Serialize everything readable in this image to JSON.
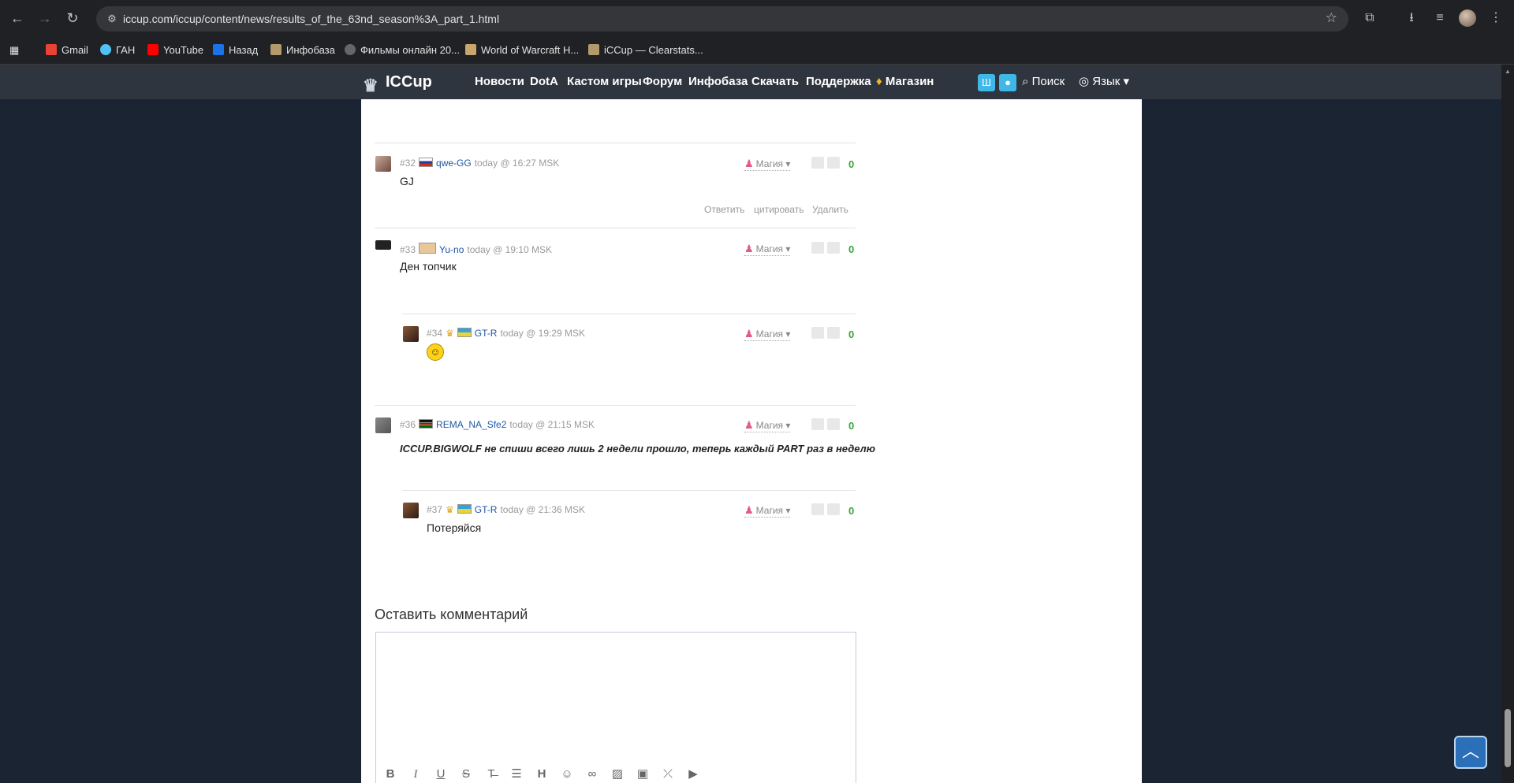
{
  "browser": {
    "url": "iccup.com/iccup/content/news/results_of_the_63nd_season%3A_part_1.html",
    "bookmarks": [
      {
        "label": "Gmail",
        "color": "#ea4335"
      },
      {
        "label": "ГАН",
        "color": "#4fc3f7"
      },
      {
        "label": "YouTube",
        "color": "#ff0000"
      },
      {
        "label": "Назад",
        "color": "#1a73e8"
      },
      {
        "label": "Инфобаза",
        "color": "#b39a6a"
      },
      {
        "label": "Фильмы онлайн 20...",
        "color": "#444444"
      },
      {
        "label": "World of Warcraft H...",
        "color": "#c9a66b"
      },
      {
        "label": "iCCup — Clearstats...",
        "color": "#b39a6a"
      }
    ]
  },
  "site": {
    "logo": "ICCup",
    "nav": [
      "Новости",
      "DotA",
      "Кастом игры",
      "Форум",
      "Инфобаза",
      "Скачать",
      "Поддержка",
      "Магазин"
    ],
    "search_label": "Поиск",
    "lang_label": "Язык"
  },
  "comments": [
    {
      "num": "#32",
      "user": "qwe-GG",
      "time": "today @ 16:27 MSK",
      "text": "GJ",
      "score": "0",
      "magic": "Магия",
      "actions": [
        "Ответить",
        "цитировать",
        "Удалить"
      ]
    },
    {
      "num": "#33",
      "user": "Yu-no",
      "time": "today @ 19:10 MSK",
      "text": "Ден топчик",
      "score": "0",
      "magic": "Магия"
    },
    {
      "num": "#34",
      "user": "GT-R",
      "time": "today @ 19:29 MSK",
      "text": "",
      "score": "0",
      "magic": "Магия",
      "reply": true
    },
    {
      "num": "#36",
      "user": "REMA_NA_Sfe2",
      "time": "today @ 21:15 MSK",
      "text": "ICCUP.BIGWOLF не спиши всего лишь 2 недели прошло, теперь каждый PART раз в неделю",
      "score": "0",
      "magic": "Магия"
    },
    {
      "num": "#37",
      "user": "GT-R",
      "time": "today @ 21:36 MSK",
      "text": "Потеряйся",
      "score": "0",
      "magic": "Магия",
      "reply": true
    }
  ],
  "leave_comment": {
    "title": "Оставить комментарий"
  },
  "editor_tools": [
    "bold-icon",
    "italic-icon",
    "underline-icon",
    "strike-icon",
    "clear-format-icon",
    "list-icon",
    "heading-icon",
    "emoji-icon",
    "link-icon",
    "image-icon",
    "gallery-icon",
    "spoiler-icon",
    "youtube-icon"
  ]
}
